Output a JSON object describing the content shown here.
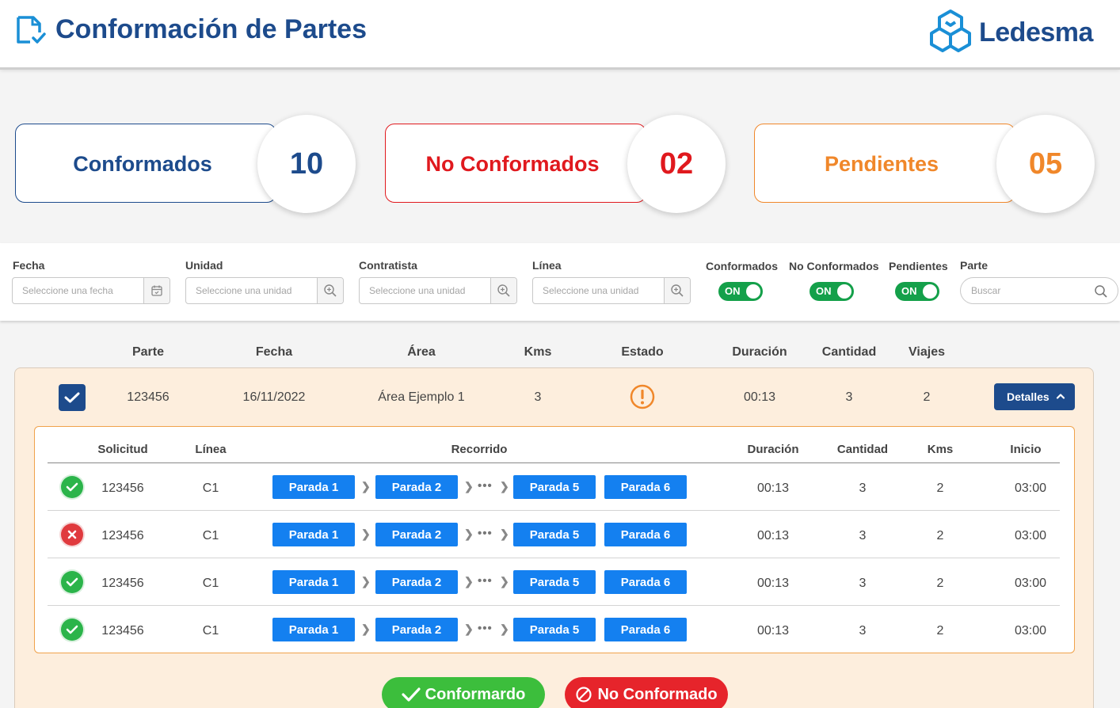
{
  "header": {
    "title": "Conformación de Partes",
    "logo_text": "Ledesma",
    "brand_color": "#1d4b8c",
    "logo_color": "#1a8fd6",
    "page_icon": "document-check-icon",
    "logo_icon": "ledesma-logo-icon"
  },
  "summary": {
    "conformados": {
      "label": "Conformados",
      "count": "10",
      "color": "#1d4b8c"
    },
    "no_conformados": {
      "label": "No Conformados",
      "count": "02",
      "color": "#e0191e"
    },
    "pendientes": {
      "label": "Pendientes",
      "count": "05",
      "color": "#f0872a"
    }
  },
  "filters": {
    "fecha": {
      "label": "Fecha",
      "placeholder": "Seleccione una fecha",
      "icon": "calendar-icon"
    },
    "unidad": {
      "label": "Unidad",
      "placeholder": "Seleccione una unidad",
      "icon": "zoom-icon"
    },
    "contratista": {
      "label": "Contratista",
      "placeholder": "Seleccione una unidad",
      "icon": "zoom-icon"
    },
    "linea": {
      "label": "Línea",
      "placeholder": "Seleccione una unidad",
      "icon": "zoom-icon"
    },
    "toggles": [
      {
        "label": "Conformados",
        "state": "ON"
      },
      {
        "label": "No Conformados",
        "state": "ON"
      },
      {
        "label": "Pendientes",
        "state": "ON"
      }
    ],
    "parte": {
      "label": "Parte",
      "placeholder": "Buscar",
      "icon": "search-icon"
    }
  },
  "table": {
    "headers": [
      "Parte",
      "Fecha",
      "Área",
      "Kms",
      "Estado",
      "Duración",
      "Cantidad",
      "Viajes"
    ],
    "row": {
      "parte": "123456",
      "fecha": "16/11/2022",
      "area": "Área Ejemplo 1",
      "kms": "3",
      "estado_icon": "warning-icon",
      "duracion": "00:13",
      "cantidad": "3",
      "viajes": "2",
      "details_label": "Detalles"
    }
  },
  "subtable": {
    "headers": [
      "Solicitud",
      "Línea",
      "Recorrido",
      "Duración",
      "Cantidad",
      "Kms",
      "Inicio"
    ],
    "rows": [
      {
        "status": "ok",
        "solicitud": "123456",
        "linea": "C1",
        "stops": [
          "Parada 1",
          "Parada 2",
          "Parada 5",
          "Parada 6"
        ],
        "duracion": "00:13",
        "cantidad": "3",
        "kms": "2",
        "inicio": "03:00"
      },
      {
        "status": "error",
        "solicitud": "123456",
        "linea": "C1",
        "stops": [
          "Parada 1",
          "Parada 2",
          "Parada 5",
          "Parada 6"
        ],
        "duracion": "00:13",
        "cantidad": "3",
        "kms": "2",
        "inicio": "03:00"
      },
      {
        "status": "ok",
        "solicitud": "123456",
        "linea": "C1",
        "stops": [
          "Parada 1",
          "Parada 2",
          "Parada 5",
          "Parada 6"
        ],
        "duracion": "00:13",
        "cantidad": "3",
        "kms": "2",
        "inicio": "03:00"
      },
      {
        "status": "ok",
        "solicitud": "123456",
        "linea": "C1",
        "stops": [
          "Parada 1",
          "Parada 2",
          "Parada 5",
          "Parada 6"
        ],
        "duracion": "00:13",
        "cantidad": "3",
        "kms": "2",
        "inicio": "03:00"
      }
    ],
    "ellipsis": "•••"
  },
  "actions": {
    "conformar_label": "Conformardo",
    "no_conformar_label": "No Conformado"
  }
}
